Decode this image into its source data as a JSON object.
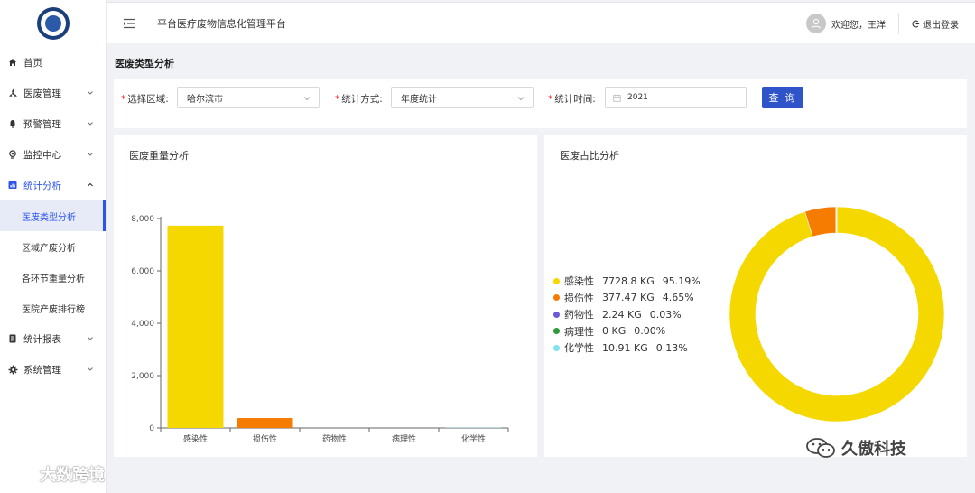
{
  "sidebar": {
    "items": [
      {
        "label": "首页",
        "icon": "home-icon"
      },
      {
        "label": "医废管理",
        "icon": "biohazard-icon"
      },
      {
        "label": "预警管理",
        "icon": "bell-icon"
      },
      {
        "label": "监控中心",
        "icon": "monitor-icon"
      },
      {
        "label": "统计分析",
        "icon": "chart-icon"
      },
      {
        "label": "统计报表",
        "icon": "report-icon"
      },
      {
        "label": "系统管理",
        "icon": "gear-icon"
      }
    ],
    "sub_items": [
      {
        "label": "医废类型分析"
      },
      {
        "label": "区域产废分析"
      },
      {
        "label": "各环节重量分析"
      },
      {
        "label": "医院产废排行榜"
      }
    ]
  },
  "header": {
    "title": "平台医疗废物信息化管理平台",
    "welcome": "欢迎您，王洋",
    "logout": "退出登录"
  },
  "page": {
    "title": "医废类型分析"
  },
  "filters": {
    "region_label": "选择区域:",
    "region_value": "哈尔滨市",
    "method_label": "统计方式:",
    "method_value": "年度统计",
    "time_label": "统计时间:",
    "time_value": "2021",
    "query_label": "查 询"
  },
  "cards": {
    "weight_title": "医废重量分析",
    "ratio_title": "医废占比分析"
  },
  "colors": {
    "infectious": "#f5d800",
    "damaging": "#f57c00",
    "pharma": "#6b5bd6",
    "pathology": "#2e9a3c",
    "chemical": "#7fe3f0",
    "primary": "#2f54c9"
  },
  "chart_data": [
    {
      "type": "bar",
      "categories": [
        "感染性",
        "损伤性",
        "药物性",
        "病理性",
        "化学性"
      ],
      "values": [
        7728.8,
        377.47,
        2.24,
        0,
        10.91
      ],
      "ylim": [
        0,
        8000
      ],
      "yticks": [
        0,
        2000,
        4000,
        6000,
        8000
      ],
      "ytick_labels": [
        "0",
        "2,000",
        "4,000",
        "6,000",
        "8,000"
      ],
      "bar_colors": [
        "#f5d800",
        "#f57c00",
        "#6b5bd6",
        "#2e9a3c",
        "#7fe3f0"
      ]
    },
    {
      "type": "pie",
      "donut": true,
      "labels": [
        "感染性",
        "损伤性",
        "药物性",
        "病理性",
        "化学性"
      ],
      "values": [
        7728.8,
        377.47,
        2.24,
        0,
        10.91
      ],
      "value_labels": [
        "7728.8 KG",
        "377.47 KG",
        "2.24 KG",
        "0 KG",
        "10.91 KG"
      ],
      "percent_labels": [
        "95.19%",
        "4.65%",
        "0.03%",
        "0.00%",
        "0.13%"
      ],
      "colors": [
        "#f5d800",
        "#f57c00",
        "#6b5bd6",
        "#2e9a3c",
        "#7fe3f0"
      ],
      "legend_position": "left"
    }
  ],
  "watermarks": {
    "left": "大数跨境",
    "right": "久傲科技"
  }
}
